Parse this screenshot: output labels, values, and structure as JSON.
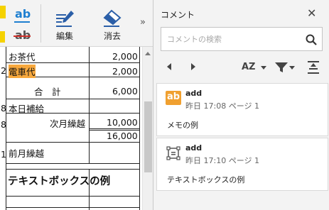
{
  "toolbar": {
    "btn1_glyph": "ab",
    "btn2_glyph": "ab",
    "edit_label": "編集",
    "erase_label": "消去",
    "more_glyph": "»"
  },
  "document": {
    "rows": [
      {
        "prefix": "",
        "label": "お茶代",
        "amount": "2,000"
      },
      {
        "prefix": "2",
        "label": "電車代",
        "amount": "2,000"
      },
      {
        "prefix": "",
        "label": "合　計",
        "amount": "6,000"
      },
      {
        "prefix": "8",
        "label": "本日補給",
        "amount": ""
      },
      {
        "prefix": "8",
        "label": "次月繰越",
        "amount": "10,000"
      },
      {
        "prefix": "",
        "label": "",
        "amount": "16,000"
      },
      {
        "prefix": "1",
        "label": "前月繰越",
        "amount": ""
      }
    ],
    "textbox_example": "テキストボックスの例"
  },
  "panel": {
    "title": "コメント",
    "close_glyph": "✕",
    "search_placeholder": "コメントの検索",
    "sort_label": "AZ",
    "comments": [
      {
        "user": "add",
        "meta": "昨日 17:08  ページ 1",
        "body": "メモの例",
        "icon": "ab-note-icon"
      },
      {
        "user": "add",
        "meta": "昨日 17:10  ページ 1",
        "body": "テキストボックスの例",
        "icon": "textbox-icon"
      }
    ]
  },
  "colors": {
    "highlight": "#f7a83d",
    "ab_blue": "#1e7fd0",
    "strike_red": "#d0302a",
    "note_orange": "#f0a030"
  }
}
